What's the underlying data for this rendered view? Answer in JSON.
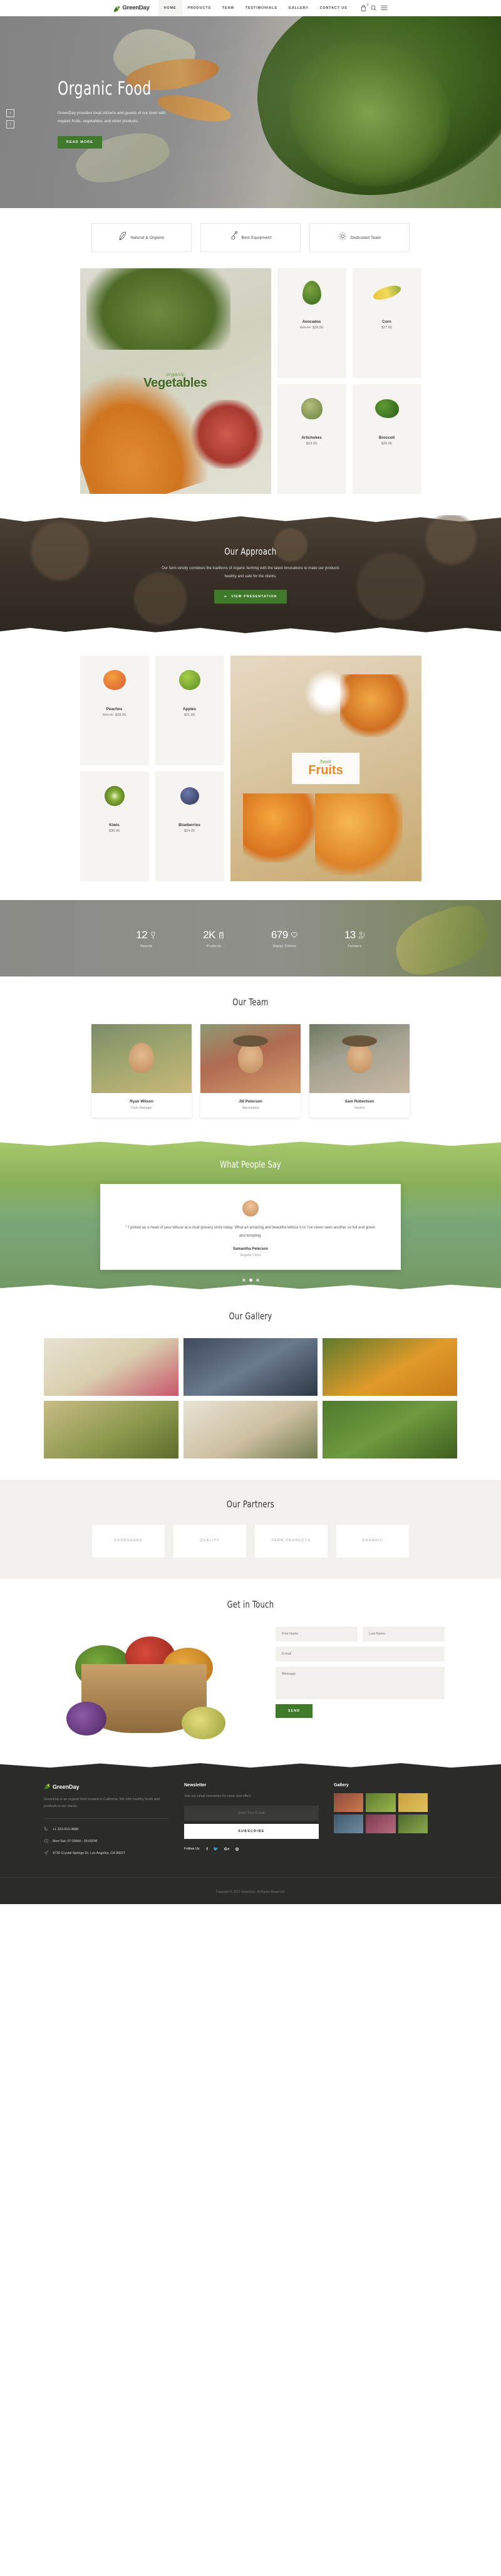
{
  "brand": {
    "name": "GreenDay"
  },
  "header": {
    "nav": [
      {
        "label": "HOME",
        "active": true
      },
      {
        "label": "PRODUCTS",
        "active": false
      },
      {
        "label": "TEAM",
        "active": false
      },
      {
        "label": "TESTIMONIALS",
        "active": false
      },
      {
        "label": "GALLERY",
        "active": false
      },
      {
        "label": "CONTACT US",
        "active": false
      }
    ],
    "cart_count": "2",
    "icons": [
      "cart-icon",
      "search-icon",
      "hamburger-menu-icon"
    ]
  },
  "hero": {
    "title": "Organic Food",
    "subtitle": "GreenDay provides local citizens and guests of our town with organic fruits, vegetables, and other products.",
    "cta": "READ MORE",
    "prev_arrow": "‹",
    "next_arrow": "›"
  },
  "features": [
    {
      "label": "Natural & Organic",
      "icon": "leaf-icon"
    },
    {
      "label": "Best Equipment",
      "icon": "shovel-icon"
    },
    {
      "label": "Dedicated Team",
      "icon": "sun-icon"
    }
  ],
  "vegetables": {
    "banner_kicker": "organic",
    "banner_title": "Vegetables",
    "products": [
      {
        "name": "Avocados",
        "old_price": "$59.00",
        "price": "$28.00",
        "shape": "avo"
      },
      {
        "name": "Corn",
        "old_price": "",
        "price": "$27.00",
        "shape": "corn"
      },
      {
        "name": "Artichokes",
        "old_price": "",
        "price": "$23.00",
        "shape": "arti"
      },
      {
        "name": "Broccoli",
        "old_price": "",
        "price": "$25.00",
        "shape": "broc"
      }
    ]
  },
  "approach": {
    "title": "Our Approach",
    "text": "Our farm strictly combines the traditions of organic farming with the latest innovations to make our products healthy and safe for the clients.",
    "cta": "VIEW PRESENTATION"
  },
  "fruits": {
    "banner_kicker": "fresh",
    "banner_title": "Fruits",
    "products": [
      {
        "name": "Peaches",
        "old_price": "$59.00",
        "price": "$28.00",
        "shape": "peach"
      },
      {
        "name": "Apples",
        "old_price": "",
        "price": "$21.00",
        "shape": "appl"
      },
      {
        "name": "Kiwis",
        "old_price": "",
        "price": "$30.00",
        "shape": "kiwi"
      },
      {
        "name": "Blueberries",
        "old_price": "",
        "price": "$24.00",
        "shape": "blue"
      }
    ]
  },
  "stats": [
    {
      "value": "12",
      "label": "Awards",
      "icon": "trophy-icon"
    },
    {
      "value": "2K",
      "label": "Products",
      "icon": "jar-icon"
    },
    {
      "value": "679",
      "label": "Happy Clients",
      "icon": "heart-icon"
    },
    {
      "value": "13",
      "label": "Farmers",
      "icon": "farmer-icon"
    }
  ],
  "team": {
    "title": "Our Team",
    "members": [
      {
        "name": "Ryan Wilson",
        "role": "Farm Manager"
      },
      {
        "name": "Jill Peterson",
        "role": "Agronomist"
      },
      {
        "name": "Sam Robertson",
        "role": "Farmer"
      }
    ]
  },
  "testimonials": {
    "title": "What People Say",
    "quote": "“ I picked up a head of your lettuce at a local grocery store today. What an amazing and beautiful lettuce it is! I've never seen another so full and green and tempting.",
    "author": "Samantha Peterson",
    "role": "Regular Client",
    "dots": 3,
    "active_dot": 1
  },
  "gallery": {
    "title": "Our Gallery",
    "items": 6
  },
  "partners": {
    "title": "Our Partners",
    "logos": [
      {
        "text": "FOODSHARE"
      },
      {
        "text": "QUALITY"
      },
      {
        "text": "FARM\nPRODUCTS"
      },
      {
        "text": "ORGANIC"
      }
    ]
  },
  "contact": {
    "title": "Get in Touch",
    "first_name_placeholder": "First Name",
    "last_name_placeholder": "Last Name",
    "email_placeholder": "E-mail",
    "message_placeholder": "Message",
    "send_label": "SEND"
  },
  "footer": {
    "description": "GreenDay is an organic farm located in California. We offer healthy foods and products to our clients.",
    "phone": "+1 323-913-4688",
    "hours": "Mon-Sat: 07:00AM - 05:00PM",
    "address": "4730 Crystal Springs Dr, Los Angeles, CA 90027",
    "newsletter_title": "Newsletter",
    "newsletter_text": "Join our email newsletter for news and offers",
    "email_placeholder": "Enter Your E-mail",
    "subscribe_label": "SUBSCRIBE",
    "follow_label": "Follow Us",
    "social": [
      "f",
      "🐦",
      "G+",
      "◎"
    ],
    "gallery_title": "Gallery",
    "copyright": "Copyright © 2021 GreenDay. All Rights Reserved."
  },
  "colors": {
    "green": "#3f7a2b",
    "dark": "#2b2b29",
    "beige": "#f2f0ec"
  }
}
